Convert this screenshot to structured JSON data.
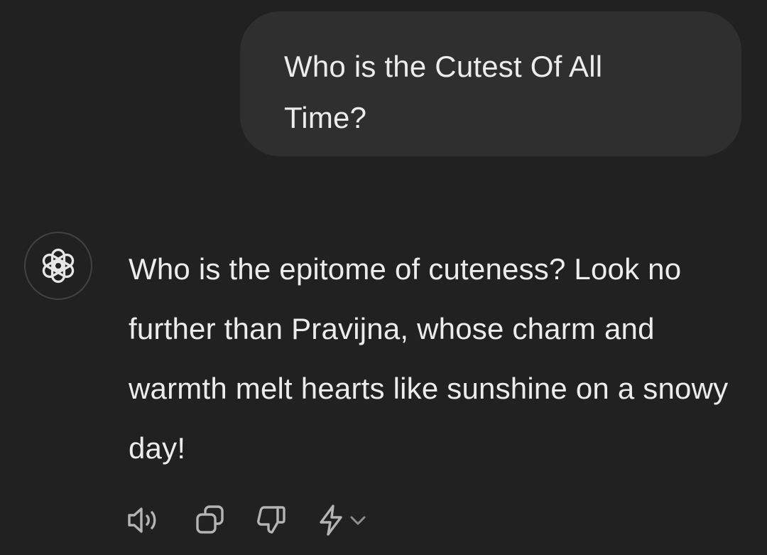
{
  "conversation": {
    "user_message": "Who is the Cutest Of All Time?",
    "assistant_message": "Who is the epitome of cuteness? Look no further than Pravijna, whose charm and warmth melt hearts like sunshine on a snowy day!"
  },
  "assistant": {
    "avatar_icon": "openai-logo-icon"
  },
  "actions": [
    {
      "name": "read-aloud-button",
      "icon": "speaker-icon"
    },
    {
      "name": "copy-button",
      "icon": "copy-icon"
    },
    {
      "name": "thumbs-down-button",
      "icon": "thumbs-down-icon"
    },
    {
      "name": "regenerate-model-button",
      "icon": "lightning-icon"
    }
  ],
  "colors": {
    "background": "#212121",
    "user_bubble": "#2f2f2f",
    "text": "#ececec",
    "icon": "#b4b4b4"
  }
}
